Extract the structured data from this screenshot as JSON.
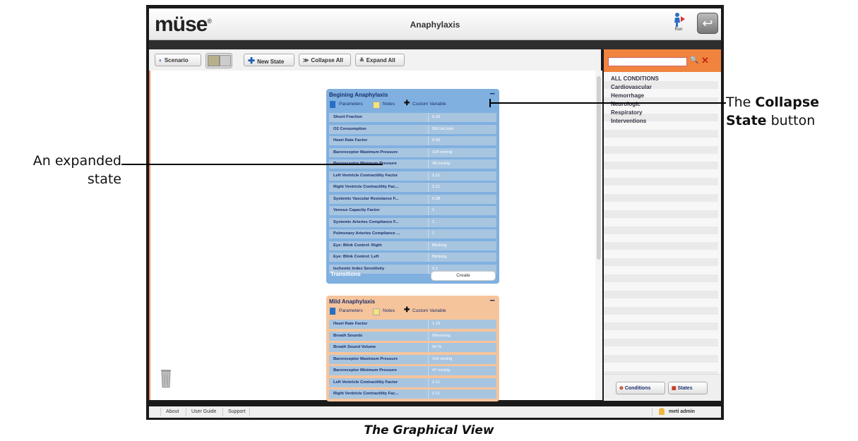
{
  "header": {
    "logo": "müse",
    "logo_mark": "®",
    "title": "Anaphylaxis",
    "run_label": "Run"
  },
  "toolbar": {
    "scenario": "Scenario",
    "new_state": "New State",
    "collapse_all": "Collapse All",
    "expand_all": "Expand All"
  },
  "states": [
    {
      "title": "Begining Anaphylaxis",
      "tabs": {
        "parameters": "Parameters",
        "notes": "Notes",
        "custom": "Custom Variable"
      },
      "collapse_symbol": "−",
      "params": [
        {
          "name": "Shunt Fraction",
          "value": "0.15"
        },
        {
          "name": "O2 Consumption",
          "value": "550 mL/min"
        },
        {
          "name": "Heart Rate Factor",
          "value": "0.93"
        },
        {
          "name": "Baroreceptor Maximum Pressure",
          "value": "104 mmHg"
        },
        {
          "name": "Baroreceptor Minimum Pressure",
          "value": "48 mmHg"
        },
        {
          "name": "Left Ventricle Contractility Factor",
          "value": "2.11"
        },
        {
          "name": "Right Ventricle Contractility Fac...",
          "value": "2.11"
        },
        {
          "name": "Systemic Vascular Resistance F...",
          "value": "0.28"
        },
        {
          "name": "Venous Capacity Factor",
          "value": "1"
        },
        {
          "name": "Systemic Arteries Compliance F...",
          "value": "1"
        },
        {
          "name": "Pulmonary Arteries Compliance ...",
          "value": "1"
        },
        {
          "name": "Eye: Blink Control: Right",
          "value": "Blinking"
        },
        {
          "name": "Eye: Blink Control: Left",
          "value": "Blinking"
        },
        {
          "name": "Ischemic Index Sensitivity",
          "value": "0.1"
        }
      ],
      "transitions_label": "Transitions",
      "create_label": "Create"
    },
    {
      "title": "Mild Anaphylaxis",
      "tabs": {
        "parameters": "Parameters",
        "notes": "Notes",
        "custom": "Custom Variable"
      },
      "collapse_symbol": "−",
      "params": [
        {
          "name": "Heart Rate Factor",
          "value": "1.15"
        },
        {
          "name": "Breath Sounds",
          "value": "Wheezing"
        },
        {
          "name": "Breath Sound Volume",
          "value": "50 %"
        },
        {
          "name": "Baroreceptor Maximum Pressure",
          "value": "104 mmHg"
        },
        {
          "name": "Baroreceptor Minimum Pressure",
          "value": "47 mmHg"
        },
        {
          "name": "Left Ventricle Contractility Factor",
          "value": "2.11"
        },
        {
          "name": "Right Ventricle Contractility Fac...",
          "value": "2.11"
        }
      ]
    }
  ],
  "sidebar": {
    "conditions": [
      "ALL CONDITIONS",
      "Cardiovascular",
      "Hemorrhage",
      "Neurologic",
      "Respiratory",
      "Interventions"
    ],
    "tab_conditions": "Conditions",
    "tab_states": "States"
  },
  "footer": {
    "about": "About",
    "user_guide": "User Guide",
    "support": "Support",
    "user": "meti admin"
  },
  "annotations": {
    "collapse_line1_pre": "The ",
    "collapse_line1_bold": "Collapse",
    "collapse_line2_bold": "State",
    "collapse_line2_post": " button",
    "expanded_line1": "An expanded",
    "expanded_line2": "state"
  },
  "caption": "The Graphical View",
  "colors": {
    "accent_orange": "#f0843f",
    "expanded_state": "#7fb0e0",
    "mild_state": "#f6c49b",
    "param_row": "#a8c5e0"
  }
}
